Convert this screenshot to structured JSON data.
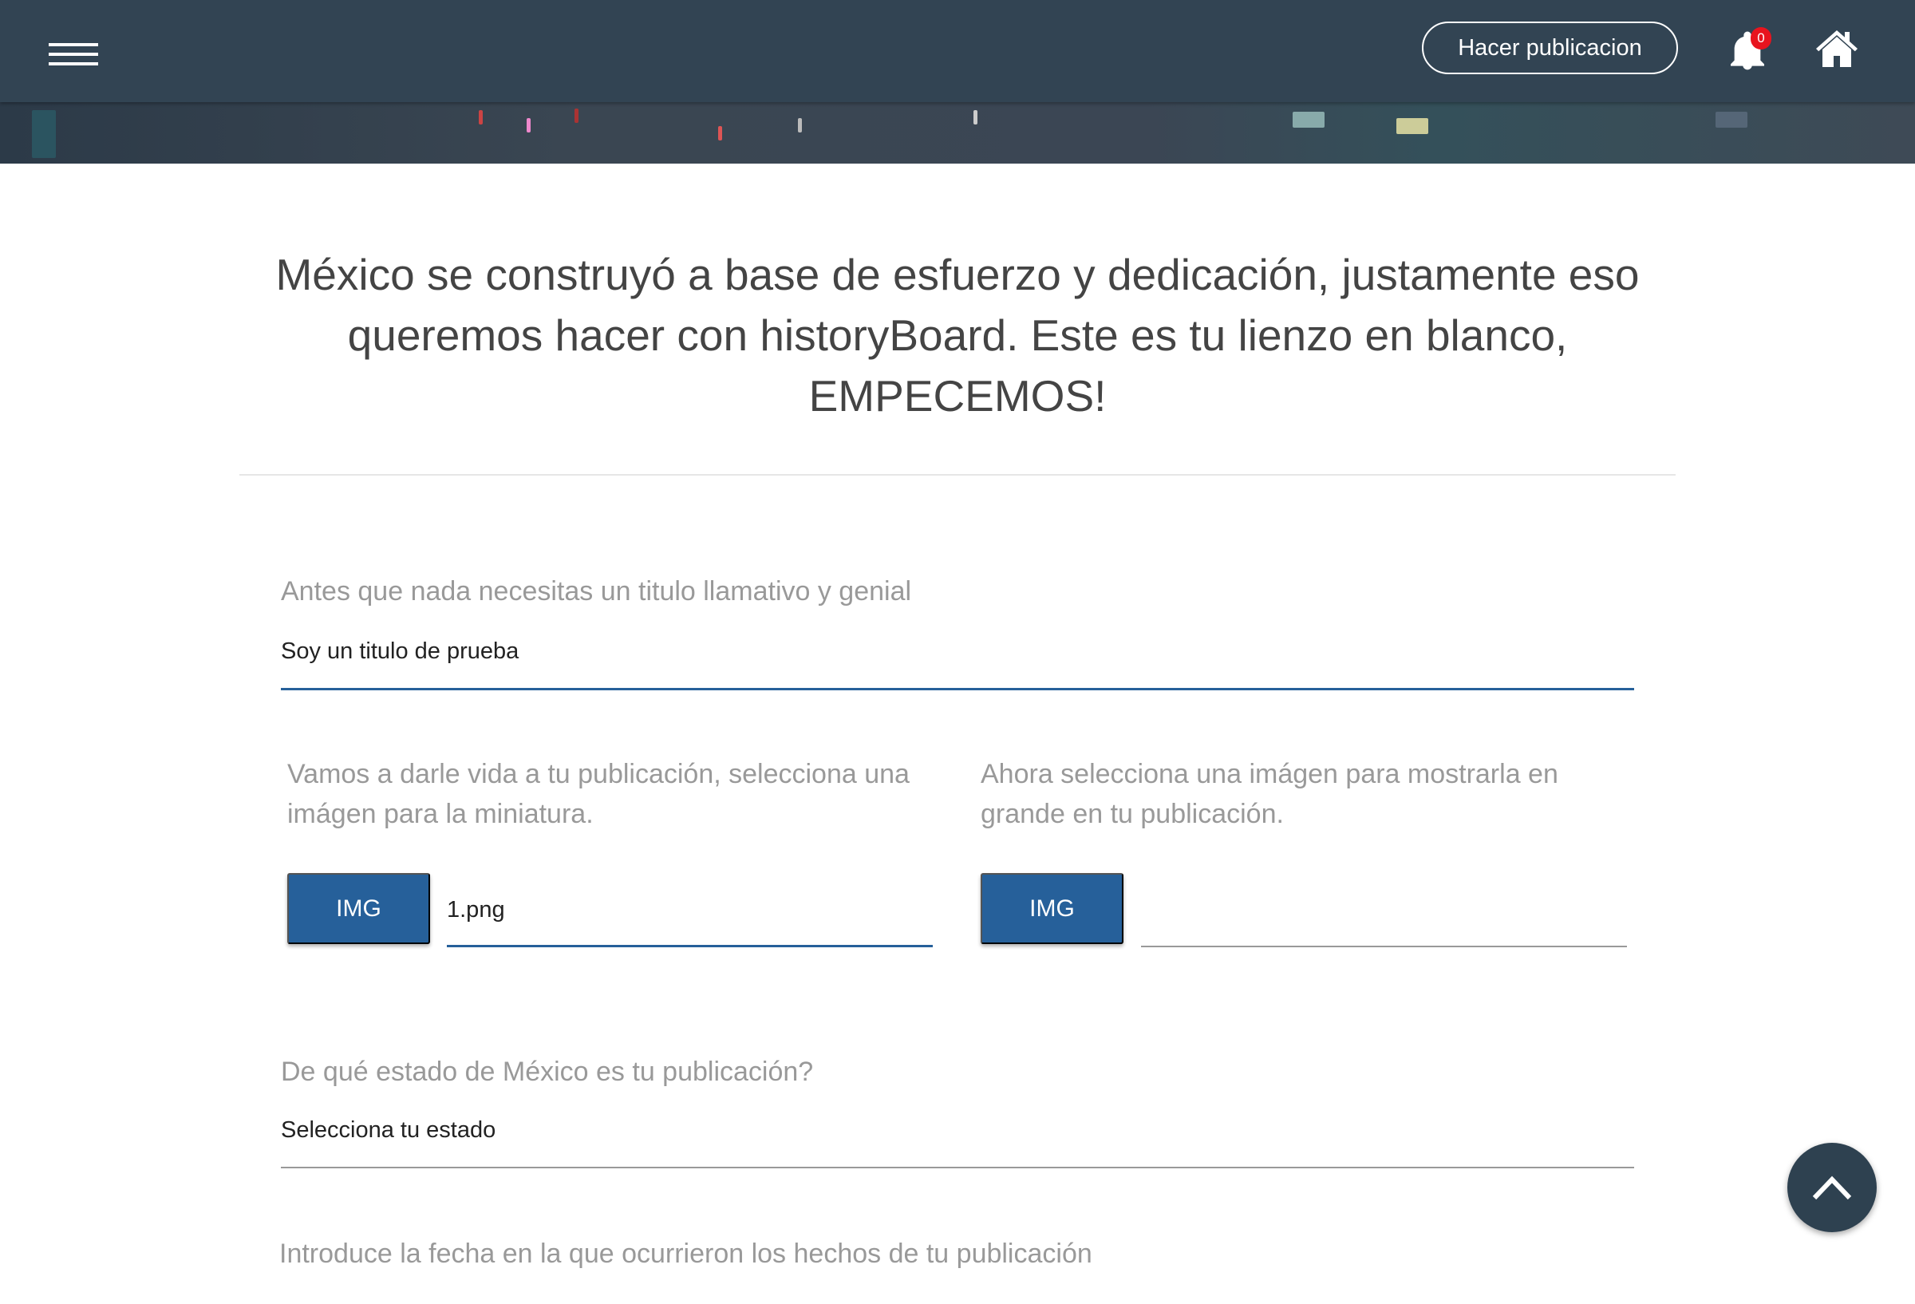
{
  "header": {
    "menu_icon": "hamburger-icon",
    "publish_button": "Hacer publicacion",
    "notification_count": "0",
    "bell_icon": "bell-icon",
    "home_icon": "home-icon"
  },
  "hero": {
    "text": "México se construyó a base de esfuerzo y dedicación, justamente eso queremos hacer con historyBoard. Este es tu lienzo en blanco, EMPECEMOS!"
  },
  "form": {
    "title_label": "Antes que nada necesitas un titulo llamativo y genial",
    "title_value": "Soy un titulo de prueba",
    "thumb_label": "Vamos a darle vida a tu publicación, selecciona una imágen para la miniatura.",
    "thumb_button": "IMG",
    "thumb_value": "1.png",
    "large_label": "Ahora selecciona una imágen para mostrarla en grande en tu publicación.",
    "large_button": "IMG",
    "large_value": "",
    "state_label": "De qué estado de México es tu publicación?",
    "state_value": "Selecciona tu estado",
    "date_label": "Introduce la fecha en la que ocurrieron los hechos de tu publicación"
  },
  "colors": {
    "header": "#324453",
    "accent": "#26609a",
    "badge": "#e8141e"
  },
  "scroll_top_icon": "chevron-up-icon"
}
